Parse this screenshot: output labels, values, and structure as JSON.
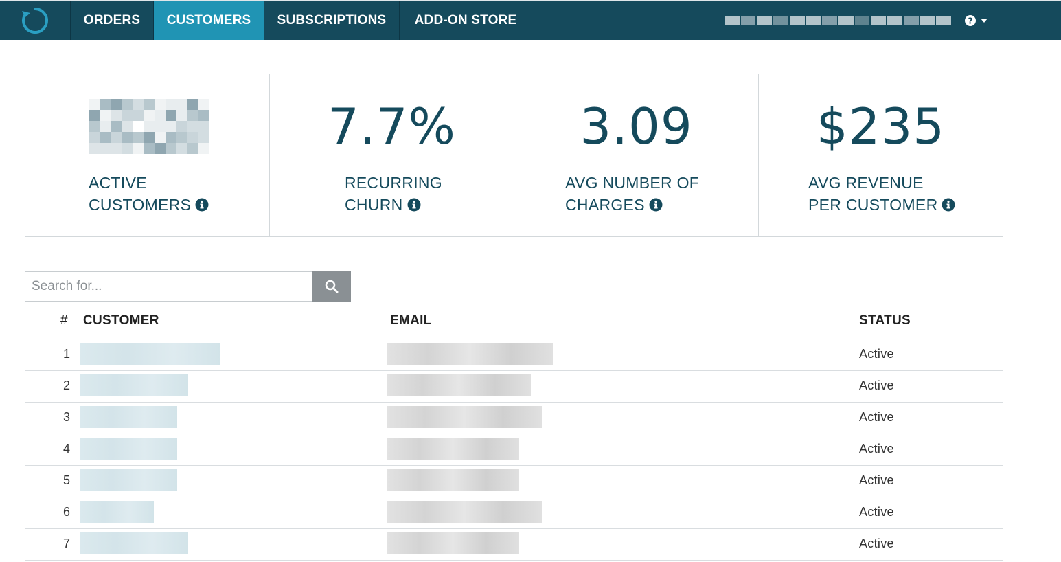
{
  "nav": {
    "items": [
      {
        "label": "ORDERS",
        "active": false
      },
      {
        "label": "CUSTOMERS",
        "active": true
      },
      {
        "label": "SUBSCRIPTIONS",
        "active": false
      },
      {
        "label": "ADD-ON STORE",
        "active": false
      }
    ],
    "help_icon": "question-circle-icon",
    "account_name_redacted": true
  },
  "colors": {
    "nav_bg": "#154a5c",
    "nav_active": "#2094b4",
    "stat_text": "#154a5c",
    "search_button": "#8a9094"
  },
  "stats": [
    {
      "value": "",
      "value_redacted": true,
      "label_line1": "ACTIVE",
      "label_line2": "CUSTOMERS"
    },
    {
      "value": "7.7%",
      "label_line1": "RECURRING",
      "label_line2": "CHURN"
    },
    {
      "value": "3.09",
      "label_line1": "AVG NUMBER OF",
      "label_line2": "CHARGES"
    },
    {
      "value": "$235",
      "label_line1": "AVG REVENUE",
      "label_line2": "PER CUSTOMER"
    }
  ],
  "search": {
    "placeholder": "Search for..."
  },
  "table": {
    "headers": {
      "num": "#",
      "customer": "CUSTOMER",
      "email": "EMAIL",
      "status": "STATUS"
    },
    "rows": [
      {
        "num": "1",
        "status": "Active"
      },
      {
        "num": "2",
        "status": "Active"
      },
      {
        "num": "3",
        "status": "Active"
      },
      {
        "num": "4",
        "status": "Active"
      },
      {
        "num": "5",
        "status": "Active"
      },
      {
        "num": "6",
        "status": "Active"
      },
      {
        "num": "7",
        "status": "Active"
      }
    ]
  }
}
